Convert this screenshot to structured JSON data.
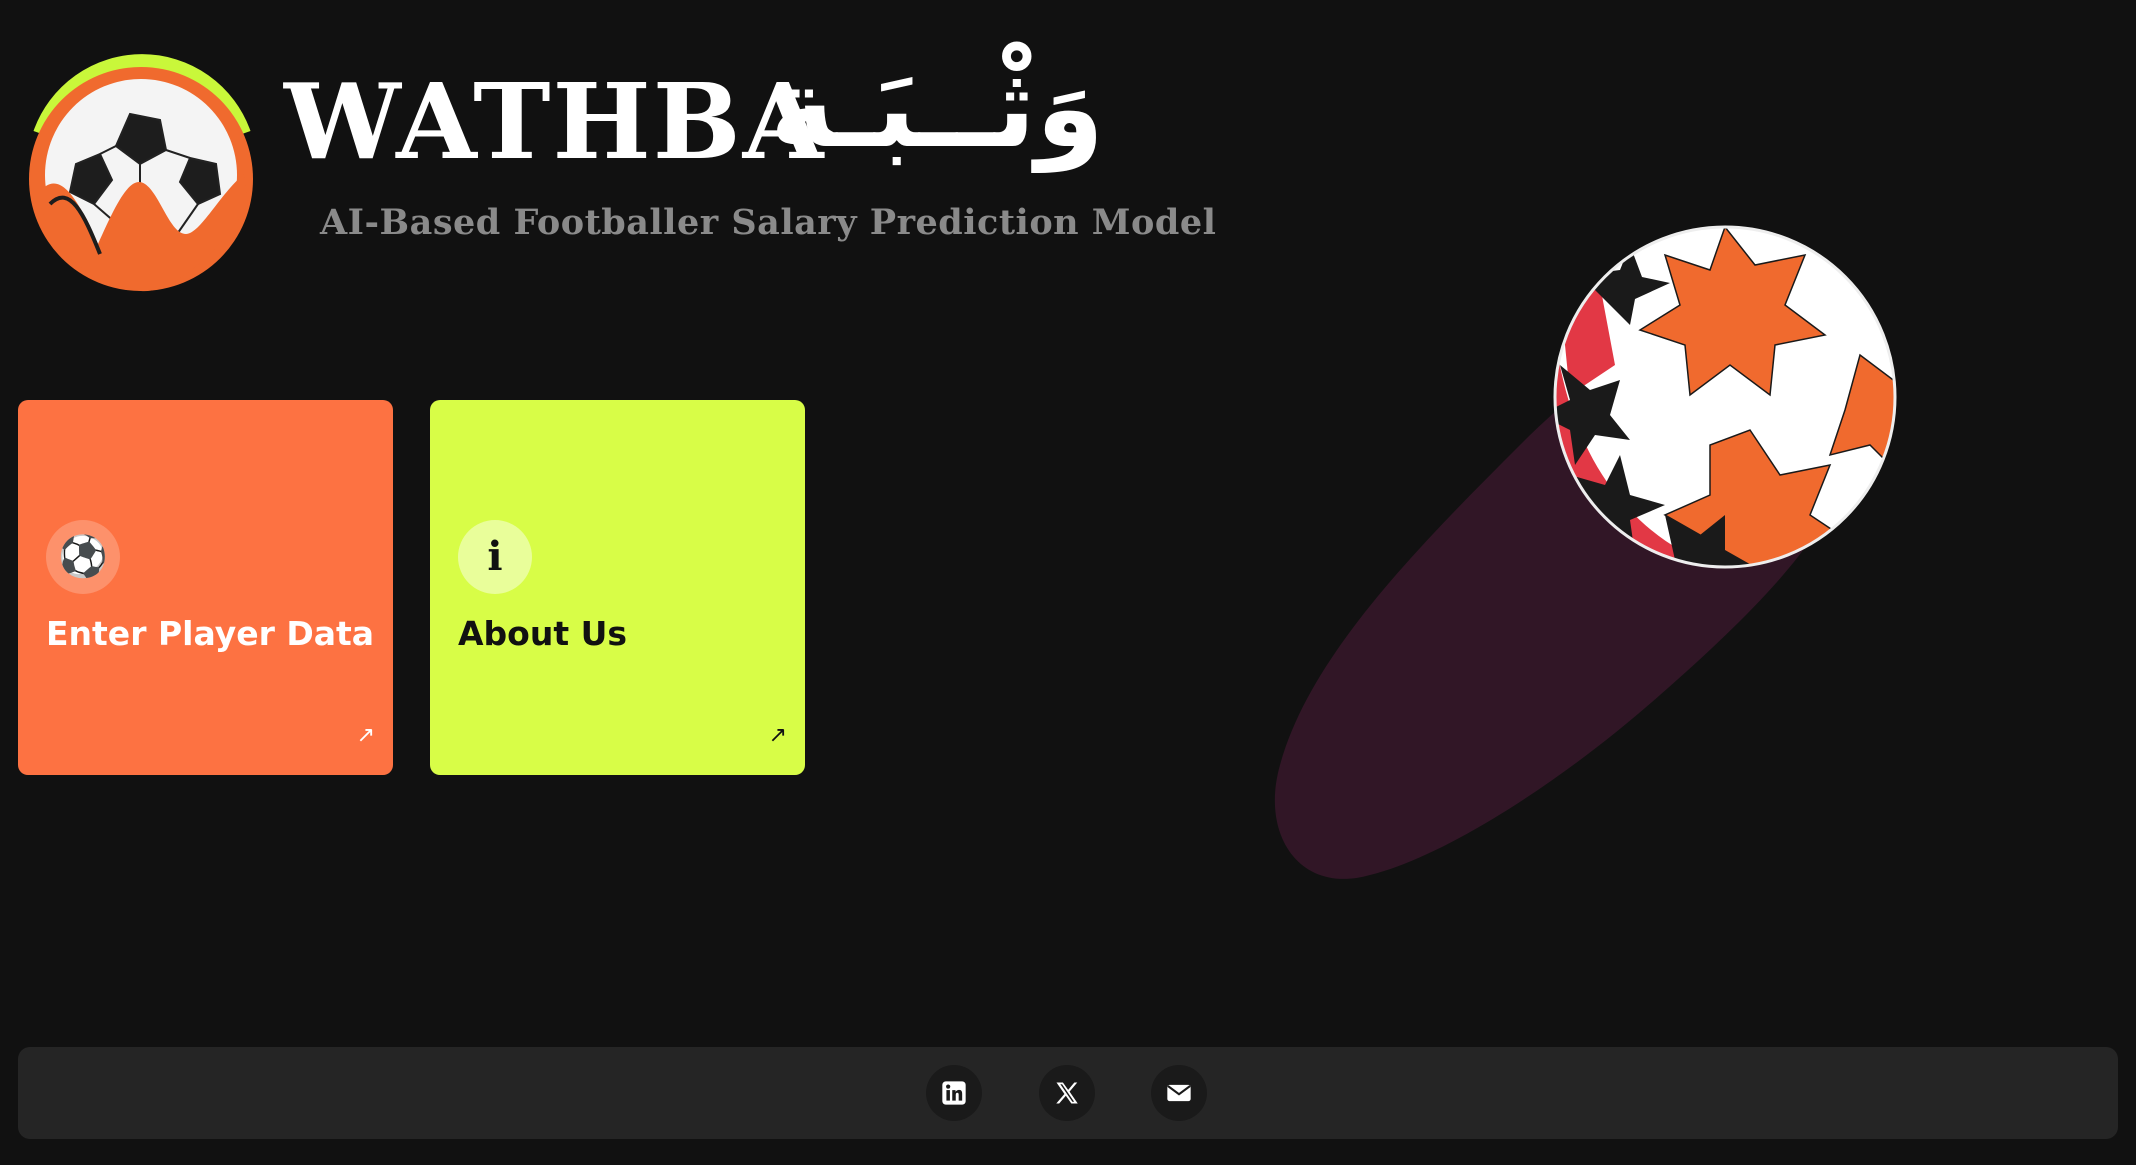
{
  "header": {
    "brand_latin": "WATHBA",
    "brand_arabic": "وَثْــبَـة",
    "tagline": "AI-Based Footballer Salary Prediction Model"
  },
  "cards": [
    {
      "label": "Enter Player Data",
      "icon": "⚽",
      "icon_name": "soccer-ball-icon",
      "arrow": "↗",
      "color": "#fd7242"
    },
    {
      "label": "About Us",
      "icon": "i",
      "icon_name": "info-icon",
      "arrow": "↗",
      "color": "#d8fd47"
    }
  ],
  "footer": {
    "socials": [
      {
        "icon_name": "linkedin-icon"
      },
      {
        "icon_name": "x-twitter-icon"
      },
      {
        "icon_name": "mail-icon"
      }
    ]
  },
  "colors": {
    "background": "#111111",
    "accent_orange": "#fd7242",
    "accent_lime": "#d8fd47",
    "footer": "#252525",
    "ball_shadow": "#311626",
    "ball_red": "#e23845"
  }
}
